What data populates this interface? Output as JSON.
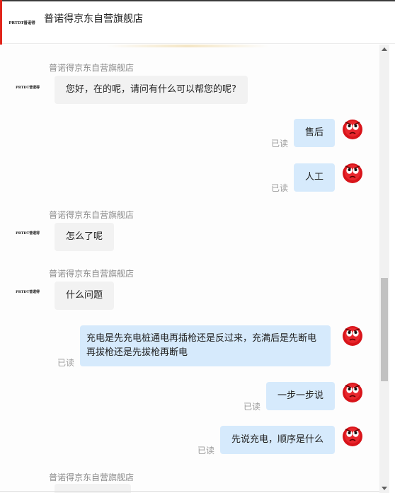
{
  "header": {
    "logo_text": "PRTDT普诺得",
    "title": "普诺得京东自营旗舰店"
  },
  "messages": [
    {
      "sender": "shop",
      "name": "普诺得京东自营旗舰店",
      "text": "您好，在的呢，请问有什么可以帮您的呢?"
    },
    {
      "sender": "user",
      "text": "售后",
      "status": "已读"
    },
    {
      "sender": "user",
      "text": "人工",
      "status": "已读"
    },
    {
      "sender": "shop",
      "name": "普诺得京东自营旗舰店",
      "text": "怎么了呢"
    },
    {
      "sender": "shop",
      "name": "普诺得京东自营旗舰店",
      "text": "什么问题"
    },
    {
      "sender": "user",
      "text": "充电是先充电桩通电再插枪还是反过来，充满后是先断电再拔枪还是先拔枪再断电",
      "status": "已读"
    },
    {
      "sender": "user",
      "text": "一步一步说",
      "status": "已读"
    },
    {
      "sender": "user",
      "text": "先说充电，顺序是什么",
      "status": "已读"
    },
    {
      "sender": "shop",
      "name": "普诺得京东自营旗舰店",
      "text": ""
    }
  ],
  "colors": {
    "user_bubble": "#d6eafc",
    "shop_bubble": "#f2f2f2",
    "read_status": "#9a9a9a",
    "accent_red": "#e1251b"
  },
  "icons": {
    "user_avatar": "red-angry-face-icon",
    "shop_avatar": "prtdt-logo"
  }
}
